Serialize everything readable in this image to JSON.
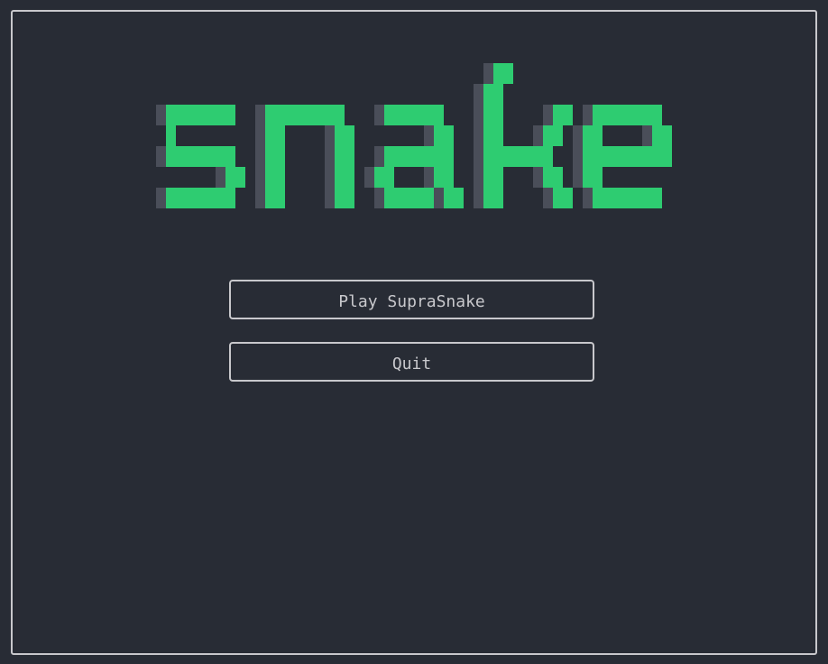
{
  "title": {
    "text": "snake",
    "accent_color": "#2ecc71",
    "shadow_color": "#4a4e59"
  },
  "menu": {
    "play_label": "Play SupraSnake",
    "quit_label": "Quit"
  },
  "colors": {
    "background": "#282c35",
    "border": "#c8c8cc",
    "button_text": "#c8c8cc"
  }
}
